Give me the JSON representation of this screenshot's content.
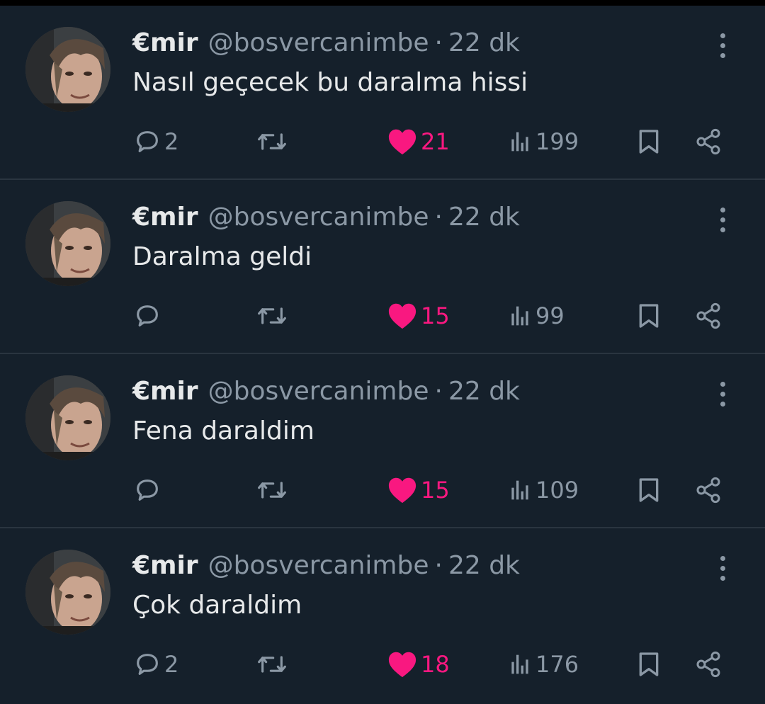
{
  "colors": {
    "background": "#15202b",
    "text": "#e7e9ea",
    "muted": "#8b98a5",
    "like": "#f91880"
  },
  "tweets": [
    {
      "name": "€mir",
      "handle": "@bosvercanimbe",
      "separator": "·",
      "time": "22 dk",
      "text": "Nasıl geçecek bu daralma hissi",
      "replies": "2",
      "likes": "21",
      "views": "199"
    },
    {
      "name": "€mir",
      "handle": "@bosvercanimbe",
      "separator": "·",
      "time": "22 dk",
      "text": "Daralma geldi",
      "replies": "",
      "likes": "15",
      "views": "99"
    },
    {
      "name": "€mir",
      "handle": "@bosvercanimbe",
      "separator": "·",
      "time": "22 dk",
      "text": "Fena daraldim",
      "replies": "",
      "likes": "15",
      "views": "109"
    },
    {
      "name": "€mir",
      "handle": "@bosvercanimbe",
      "separator": "·",
      "time": "22 dk",
      "text": "Çok daraldim",
      "replies": "2",
      "likes": "18",
      "views": "176"
    }
  ],
  "icons": [
    "avatar-image",
    "more-icon",
    "reply-icon",
    "retweet-icon",
    "heart-icon",
    "views-icon",
    "bookmark-icon",
    "share-icon"
  ]
}
